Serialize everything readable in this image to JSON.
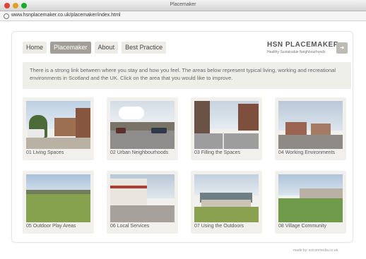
{
  "window": {
    "title": "Placemaker",
    "url": "www.hsnplacemaker.co.uk/placemaker/index.html"
  },
  "nav": {
    "items": [
      {
        "label": "Home"
      },
      {
        "label": "Placemaker"
      },
      {
        "label": "About"
      },
      {
        "label": "Best Practice"
      }
    ],
    "active": "Placemaker"
  },
  "brand": {
    "title": "HSN PLACEMAKER",
    "subtitle": "Healthy Sustainable Neighbourhoods",
    "icon": "arrow-right-icon"
  },
  "intro": {
    "text": "There is a strong link between where you stay and how you feel. The areas below represent typical living, working and recreational environments in Scotland and the UK. Click on the area that you would like to improve."
  },
  "tiles": [
    {
      "caption": "01  Living Spaces",
      "scene": "street-houses"
    },
    {
      "caption": "02  Urban Neighbourhoods",
      "scene": "parked-cars-road"
    },
    {
      "caption": "03  Filling the Spaces",
      "scene": "empty-road-blocks"
    },
    {
      "caption": "04  Working Environments",
      "scene": "suburban-houses"
    },
    {
      "caption": "05  Outdoor Play Areas",
      "scene": "playing-field"
    },
    {
      "caption": "06  Local Services",
      "scene": "shop-front"
    },
    {
      "caption": "07  Using the Outdoors",
      "scene": "pavilion-green"
    },
    {
      "caption": "08  Village Community",
      "scene": "hillside-houses"
    }
  ],
  "footer": {
    "text": "made by: sciconmedia.co.uk"
  },
  "colors": {
    "nav_active": "#a19f97",
    "nav_inactive": "#ecebe6",
    "intro_bg": "#efefea",
    "card_bg": "#f1f0ec"
  }
}
